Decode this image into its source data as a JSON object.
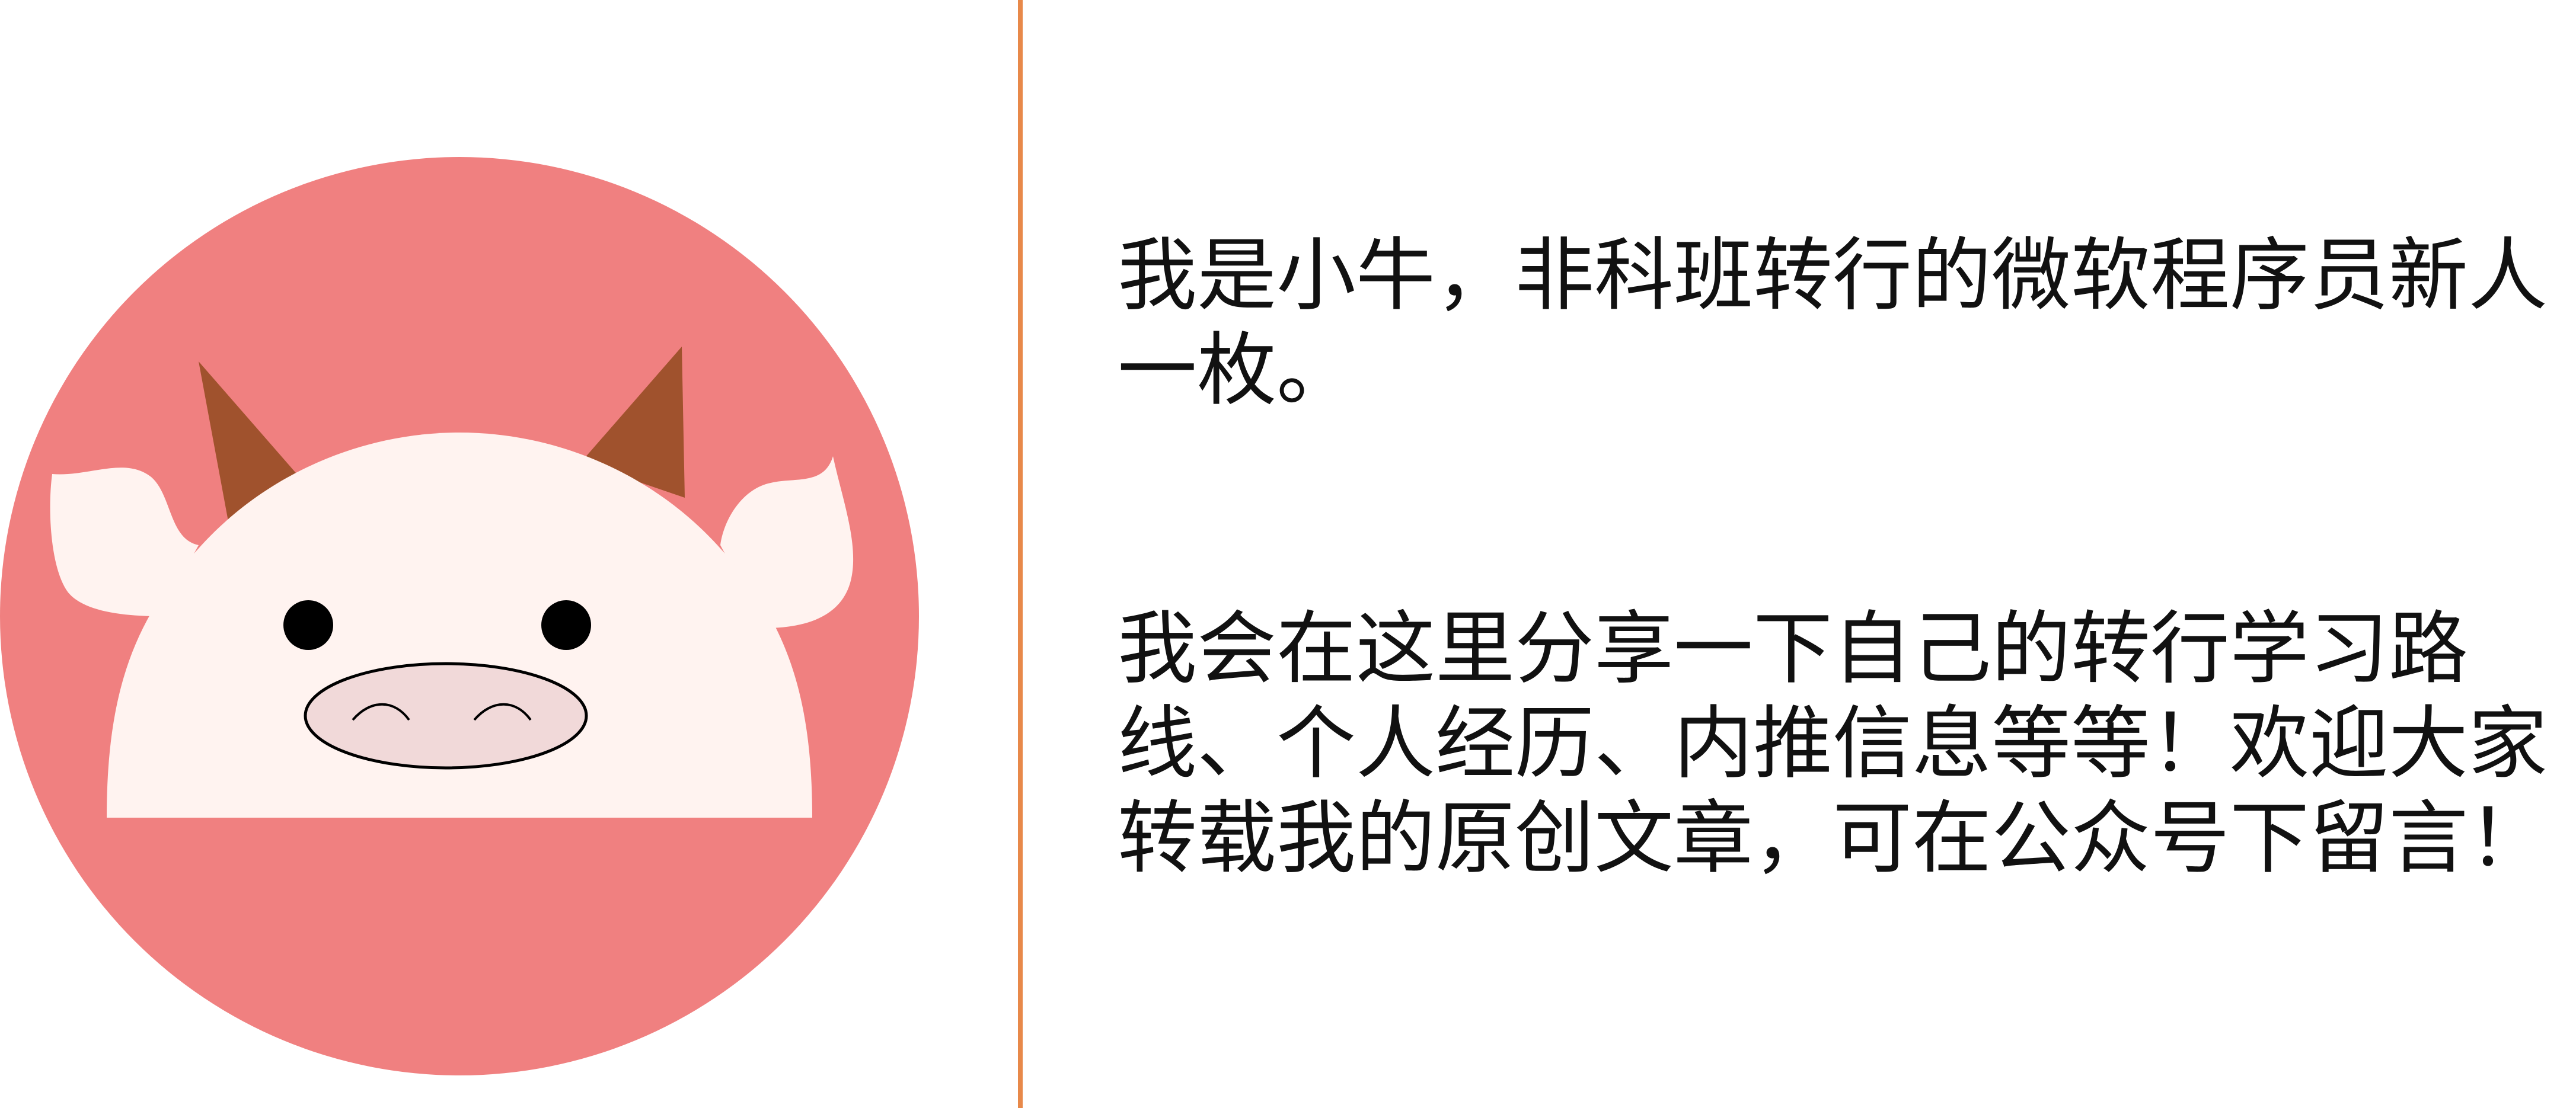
{
  "colors": {
    "circle": "#f08080",
    "face": "#fff3f0",
    "horn": "#a0522d",
    "eye": "#000000",
    "snout": "#f1d9d9",
    "divider": "#e8894a",
    "text": "#111111"
  },
  "avatar": {
    "icon": "cartoon-cow-icon"
  },
  "intro": {
    "paragraph_1": "我是小牛，非科班转行的微软程序员新人\n一枚。",
    "paragraph_2": "我会在这里分享一下自己的转行学习路\n线、个人经历、内推信息等等！欢迎大家\n转载我的原创文章，可在公众号下留言！"
  }
}
